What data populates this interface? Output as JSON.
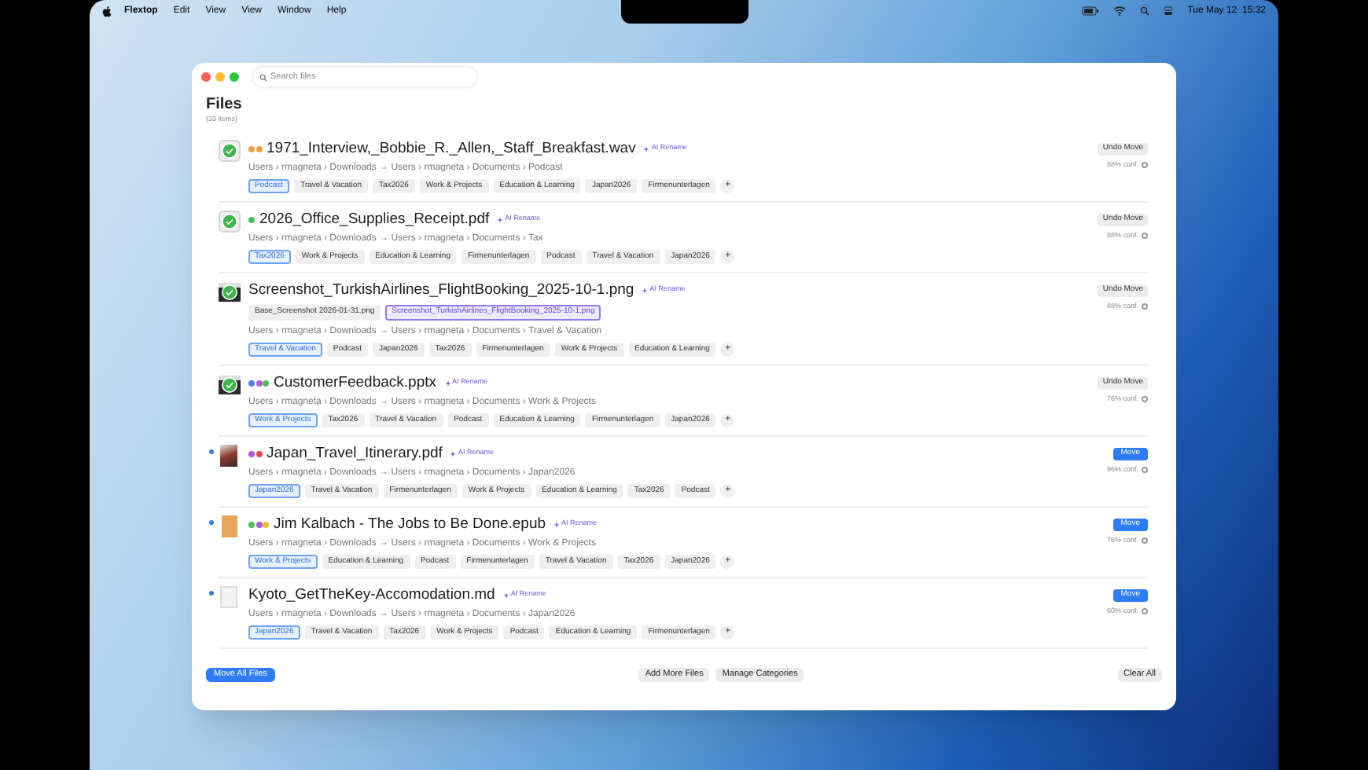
{
  "menubar": {
    "app": "Flextop",
    "menus": [
      "Edit",
      "View",
      "View",
      "Window",
      "Help"
    ],
    "clock": "Tue May 12  15:32"
  },
  "search": {
    "placeholder": "Search files"
  },
  "header": {
    "title": "Files",
    "count": "(33 items)"
  },
  "files": [
    {
      "name": "1971_Interview,_Bobbie_R._Allen,_Staff_Breakfast.wav",
      "kind": "audio",
      "moved": true,
      "unread": false,
      "dots": [
        {
          "color": "#e8a33c"
        },
        {
          "color": "#e8a33c"
        }
      ],
      "rename": "AI Rename",
      "path": "Users › rmagneta › Downloads → Users › rmagneta › Documents › Podcast",
      "categories": [
        {
          "label": "Podcast",
          "selected": true
        },
        {
          "label": "Travel & Vacation",
          "selected": false
        },
        {
          "label": "Tax2026",
          "selected": false
        },
        {
          "label": "Work & Projects",
          "selected": false
        },
        {
          "label": "Education & Learning",
          "selected": false
        },
        {
          "label": "Japan2026",
          "selected": false
        },
        {
          "label": "Firmenunterlagen",
          "selected": false
        }
      ],
      "add": "+",
      "action": {
        "kind": "undo",
        "label": "Undo Move"
      },
      "confidence": "88% conf."
    },
    {
      "name": "2026_Office_Supplies_Receipt.pdf",
      "kind": "pdf",
      "moved": true,
      "unread": false,
      "dots": [
        {
          "color": "#4cbf5a"
        }
      ],
      "rename": "AI Rename",
      "path": "Users › rmagneta › Downloads → Users › rmagneta › Documents › Tax",
      "categories": [
        {
          "label": "Tax2026",
          "selected": true
        },
        {
          "label": "Work & Projects",
          "selected": false
        },
        {
          "label": "Education & Learning",
          "selected": false
        },
        {
          "label": "Firmenunterlagen",
          "selected": false
        },
        {
          "label": "Podcast",
          "selected": false
        },
        {
          "label": "Travel & Vacation",
          "selected": false
        },
        {
          "label": "Japan2026",
          "selected": false
        }
      ],
      "add": "+",
      "action": {
        "kind": "undo",
        "label": "Undo Move"
      },
      "confidence": "88% conf."
    },
    {
      "name": "Screenshot_TurkishAirlines_FlightBooking_2025-10-1.png",
      "kind": "screenshot",
      "moved": true,
      "unread": false,
      "rename": "AI Rename",
      "path": "Users › rmagneta › Downloads → Users › rmagneta › Documents › Travel & Vacation",
      "alternatives": [
        {
          "label": "Base_Screenshot 2026-01-31.png",
          "selected": false
        },
        {
          "label": "Screenshot_TurkishAirlines_FlightBooking_2025-10-1.png",
          "selected": true
        }
      ],
      "categories": [
        {
          "label": "Travel & Vacation",
          "selected": true
        },
        {
          "label": "Podcast",
          "selected": false
        },
        {
          "label": "Japan2026",
          "selected": false
        },
        {
          "label": "Tax2026",
          "selected": false
        },
        {
          "label": "Firmenunterlagen",
          "selected": false
        },
        {
          "label": "Work & Projects",
          "selected": false
        },
        {
          "label": "Education & Learning",
          "selected": false
        }
      ],
      "add": "+",
      "action": {
        "kind": "undo",
        "label": "Undo Move"
      },
      "confidence": "88% conf."
    },
    {
      "name": "CustomerFeedback.pptx",
      "kind": "screenshot",
      "moved": true,
      "unread": false,
      "dots": [
        {
          "color": "#4a7ee8"
        },
        {
          "color": "#b25ad8"
        },
        {
          "color": "#4cbf5a"
        }
      ],
      "rename": "AI Rename",
      "path": "Users › rmagneta › Downloads → Users › rmagneta › Documents › Work & Projects",
      "categories": [
        {
          "label": "Work & Projects",
          "selected": true
        },
        {
          "label": "Tax2026",
          "selected": false
        },
        {
          "label": "Travel & Vacation",
          "selected": false
        },
        {
          "label": "Podcast",
          "selected": false
        },
        {
          "label": "Education & Learning",
          "selected": false
        },
        {
          "label": "Firmenunterlagen",
          "selected": false
        },
        {
          "label": "Japan2026",
          "selected": false
        }
      ],
      "add": "+",
      "action": {
        "kind": "undo",
        "label": "Undo Move"
      },
      "confidence": "76% conf."
    },
    {
      "name": "Japan_Travel_Itinerary.pdf",
      "kind": "photo",
      "moved": false,
      "unread": true,
      "dots": [
        {
          "color": "#b25ad8"
        },
        {
          "color": "#e0484a"
        }
      ],
      "rename": "AI Rename",
      "path": "Users › rmagneta › Downloads → Users › rmagneta › Documents › Japan2026",
      "categories": [
        {
          "label": "Japan2026",
          "selected": true
        },
        {
          "label": "Travel & Vacation",
          "selected": false
        },
        {
          "label": "Firmenunterlagen",
          "selected": false
        },
        {
          "label": "Work & Projects",
          "selected": false
        },
        {
          "label": "Education & Learning",
          "selected": false
        },
        {
          "label": "Tax2026",
          "selected": false
        },
        {
          "label": "Podcast",
          "selected": false
        }
      ],
      "add": "+",
      "action": {
        "kind": "move",
        "label": "Move"
      },
      "confidence": "96% conf."
    },
    {
      "name": "Jim Kalbach - The Jobs to Be Done.epub",
      "kind": "book",
      "moved": false,
      "unread": true,
      "dots": [
        {
          "color": "#4cbf5a"
        },
        {
          "color": "#b25ad8"
        },
        {
          "color": "#e8c23c"
        }
      ],
      "rename": "AI Rename",
      "path": "Users › rmagneta › Downloads → Users › rmagneta › Documents › Work & Projects",
      "categories": [
        {
          "label": "Work & Projects",
          "selected": true
        },
        {
          "label": "Education & Learning",
          "selected": false
        },
        {
          "label": "Podcast",
          "selected": false
        },
        {
          "label": "Firmenunterlagen",
          "selected": false
        },
        {
          "label": "Travel & Vacation",
          "selected": false
        },
        {
          "label": "Tax2026",
          "selected": false
        },
        {
          "label": "Japan2026",
          "selected": false
        }
      ],
      "add": "+",
      "action": {
        "kind": "move",
        "label": "Move"
      },
      "confidence": "76% conf."
    },
    {
      "name": "Kyoto_GetTheKey-Accomodation.md",
      "kind": "document",
      "moved": false,
      "unread": true,
      "rename": "AI Rename",
      "path": "Users › rmagneta › Downloads → Users › rmagneta › Documents › Japan2026",
      "categories": [
        {
          "label": "Japan2026",
          "selected": true
        },
        {
          "label": "Travel & Vacation",
          "selected": false
        },
        {
          "label": "Tax2026",
          "selected": false
        },
        {
          "label": "Work & Projects",
          "selected": false
        },
        {
          "label": "Podcast",
          "selected": false
        },
        {
          "label": "Education & Learning",
          "selected": false
        },
        {
          "label": "Firmenunterlagen",
          "selected": false
        }
      ],
      "add": "+",
      "action": {
        "kind": "move",
        "label": "Move"
      },
      "confidence": "60% conf."
    }
  ],
  "footer": {
    "primary": "Move All Files",
    "center": [
      "Add More Files",
      "Manage Categories"
    ],
    "clear": "Clear All"
  }
}
